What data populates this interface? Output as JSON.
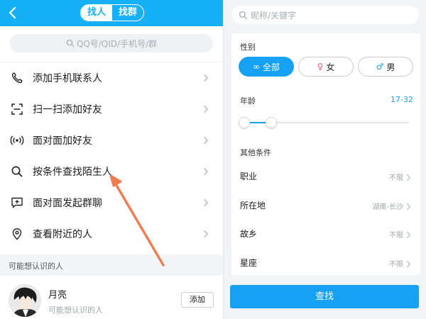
{
  "left": {
    "tabs": [
      "找人",
      "找群"
    ],
    "search_placeholder": "QQ号/QID/手机号/群",
    "menu": [
      {
        "label": "添加手机联系人",
        "icon": "phone-icon"
      },
      {
        "label": "扫一扫添加好友",
        "icon": "scan-icon"
      },
      {
        "label": "面对面加好友",
        "icon": "nearby-signal-icon"
      },
      {
        "label": "按条件查找陌生人",
        "icon": "search-icon"
      },
      {
        "label": "面对面发起群聊",
        "icon": "group-chat-icon"
      },
      {
        "label": "查看附近的人",
        "icon": "location-pin-icon"
      }
    ],
    "section_title": "可能想认识的人",
    "person": {
      "name": "月亮",
      "subtitle": "可能想认识的人",
      "add_label": "添加"
    }
  },
  "right": {
    "search_placeholder": "昵称/关键字",
    "gender_label": "性别",
    "gender_options": [
      {
        "label": "全部",
        "glyph": "∞",
        "selected": true
      },
      {
        "label": "女",
        "glyph": "♀",
        "selected": false
      },
      {
        "label": "男",
        "glyph": "♂",
        "selected": false
      }
    ],
    "age_label": "年龄",
    "age_value": "17-32",
    "other_label": "其他条件",
    "conditions": [
      {
        "label": "职业",
        "value": "不限"
      },
      {
        "label": "所在地",
        "value": "湖南-长沙"
      },
      {
        "label": "故乡",
        "value": "不限"
      },
      {
        "label": "星座",
        "value": "不限"
      }
    ],
    "find_label": "查找"
  },
  "colors": {
    "accent": "#16a1f5",
    "header": "#16b0f7",
    "annotation_arrow": "#f07d52"
  }
}
